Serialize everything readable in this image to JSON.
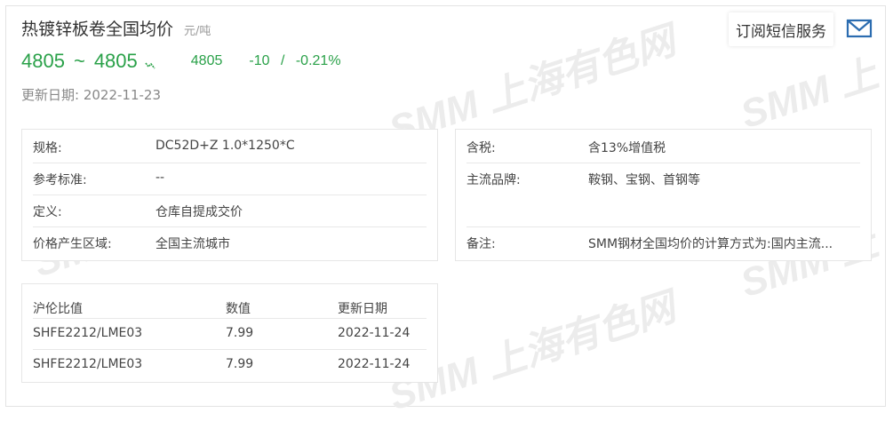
{
  "header": {
    "title": "热镀锌板卷全国均价",
    "unit": "元/吨",
    "price_low": "4805",
    "tilde": "~",
    "price_high": "4805",
    "trend_icon": "down-trend-icon",
    "avg_price": "4805",
    "change": "-10",
    "separator": "/",
    "change_pct": "-0.21%",
    "update_label": "更新日期:",
    "update_date": "2022-11-23",
    "accent_color": "#2aa149"
  },
  "actions": {
    "subscribe_label": "订阅短信服务",
    "mail_icon": "mail-icon",
    "mail_color": "#2b6cb0"
  },
  "spec_left": [
    {
      "label": "规格:",
      "value": "DC52D+Z 1.0*1250*C"
    },
    {
      "label": "参考标准:",
      "value": "--"
    },
    {
      "label": "定义:",
      "value": "仓库自提成交价"
    },
    {
      "label": "价格产生区域:",
      "value": "全国主流城市"
    }
  ],
  "spec_right": [
    {
      "label": "含税:",
      "value": "含13%增值税"
    },
    {
      "label": "主流品牌:",
      "value": "鞍钢、宝钢、首钢等"
    },
    {
      "label": "备注:",
      "value": "SMM钢材全国均价的计算方式为:国内主流..."
    }
  ],
  "ratio_table": {
    "headers": [
      "沪伦比值",
      "数值",
      "更新日期"
    ],
    "rows": [
      [
        "SHFE2212/LME03",
        "7.99",
        "2022-11-24"
      ],
      [
        "SHFE2212/LME03",
        "7.99",
        "2022-11-24"
      ]
    ]
  },
  "watermark": {
    "text": "SMM 上海有色网",
    "text_short": "SMM 上"
  }
}
